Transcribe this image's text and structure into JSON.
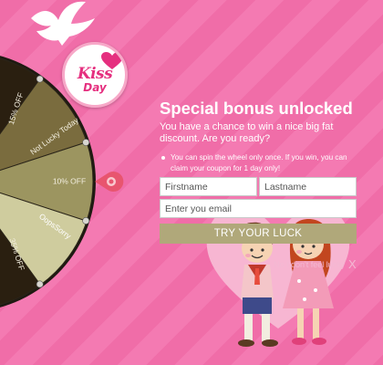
{
  "logo": {
    "word1": "Kiss",
    "word2": "Day"
  },
  "wheel": {
    "segments": [
      {
        "label": "15% OFF",
        "color": "#2a1f10"
      },
      {
        "label": "Not Lucky Today",
        "color": "#7a6c3e"
      },
      {
        "label": "10% OFF",
        "color": "#9c9560"
      },
      {
        "label": "OopsSorry",
        "color": "#cfcc9e"
      },
      {
        "label": "35% OFF",
        "color": "#2a1f10"
      }
    ],
    "pointer_color": "#e8556f"
  },
  "content": {
    "title": "Special bonus unlocked",
    "subtitle": "You have a chance to win a nice big fat discount. Are you ready?",
    "note": "You can spin the wheel only once. If you win, you can claim your coupon for 1 day only!"
  },
  "form": {
    "firstname_placeholder": "Firstname",
    "lastname_placeholder": "Lastname",
    "email_placeholder": "Enter you email",
    "button_label": "TRY YOUR LUCK"
  },
  "footer": {
    "decline_label": "No I don't feel lucky",
    "close_label": "X"
  },
  "colors": {
    "background": "#f06da8",
    "button": "#b0a87a",
    "accent": "#e52f7f"
  }
}
